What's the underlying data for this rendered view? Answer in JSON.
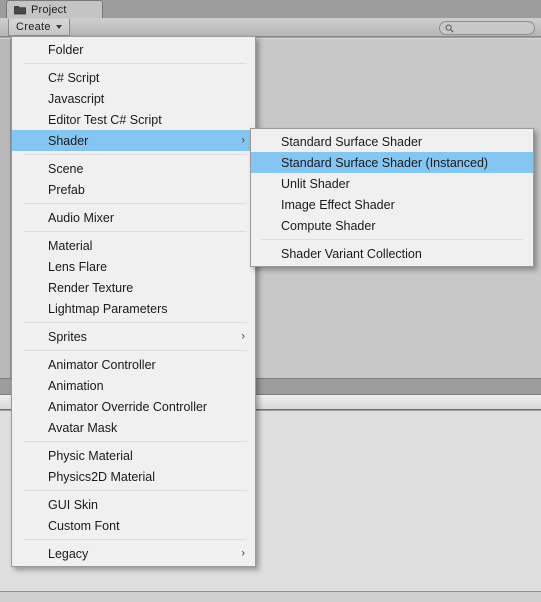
{
  "window": {
    "tab": {
      "label": "Project",
      "icon": "folder-icon"
    }
  },
  "toolbar": {
    "create_label": "Create",
    "create_caret_icon": "chevron-down-icon",
    "search": {
      "value": "",
      "placeholder": "",
      "icon": "search-icon"
    }
  },
  "create_menu": {
    "groups": [
      {
        "items": [
          {
            "label": "Folder",
            "has_submenu": false,
            "highlighted": false
          }
        ]
      },
      {
        "items": [
          {
            "label": "C# Script",
            "has_submenu": false,
            "highlighted": false
          },
          {
            "label": "Javascript",
            "has_submenu": false,
            "highlighted": false
          },
          {
            "label": "Editor Test C# Script",
            "has_submenu": false,
            "highlighted": false
          },
          {
            "label": "Shader",
            "has_submenu": true,
            "highlighted": true
          }
        ]
      },
      {
        "items": [
          {
            "label": "Scene",
            "has_submenu": false,
            "highlighted": false
          },
          {
            "label": "Prefab",
            "has_submenu": false,
            "highlighted": false
          }
        ]
      },
      {
        "items": [
          {
            "label": "Audio Mixer",
            "has_submenu": false,
            "highlighted": false
          }
        ]
      },
      {
        "items": [
          {
            "label": "Material",
            "has_submenu": false,
            "highlighted": false
          },
          {
            "label": "Lens Flare",
            "has_submenu": false,
            "highlighted": false
          },
          {
            "label": "Render Texture",
            "has_submenu": false,
            "highlighted": false
          },
          {
            "label": "Lightmap Parameters",
            "has_submenu": false,
            "highlighted": false
          }
        ]
      },
      {
        "items": [
          {
            "label": "Sprites",
            "has_submenu": true,
            "highlighted": false
          }
        ]
      },
      {
        "items": [
          {
            "label": "Animator Controller",
            "has_submenu": false,
            "highlighted": false
          },
          {
            "label": "Animation",
            "has_submenu": false,
            "highlighted": false
          },
          {
            "label": "Animator Override Controller",
            "has_submenu": false,
            "highlighted": false
          },
          {
            "label": "Avatar Mask",
            "has_submenu": false,
            "highlighted": false
          }
        ]
      },
      {
        "items": [
          {
            "label": "Physic Material",
            "has_submenu": false,
            "highlighted": false
          },
          {
            "label": "Physics2D Material",
            "has_submenu": false,
            "highlighted": false
          }
        ]
      },
      {
        "items": [
          {
            "label": "GUI Skin",
            "has_submenu": false,
            "highlighted": false
          },
          {
            "label": "Custom Font",
            "has_submenu": false,
            "highlighted": false
          }
        ]
      },
      {
        "items": [
          {
            "label": "Legacy",
            "has_submenu": true,
            "highlighted": false
          }
        ]
      }
    ]
  },
  "shader_submenu": {
    "groups": [
      {
        "items": [
          {
            "label": "Standard Surface Shader",
            "has_submenu": false,
            "highlighted": false
          },
          {
            "label": "Standard Surface Shader (Instanced)",
            "has_submenu": false,
            "highlighted": true
          },
          {
            "label": "Unlit Shader",
            "has_submenu": false,
            "highlighted": false
          },
          {
            "label": "Image Effect Shader",
            "has_submenu": false,
            "highlighted": false
          },
          {
            "label": "Compute Shader",
            "has_submenu": false,
            "highlighted": false
          }
        ]
      },
      {
        "items": [
          {
            "label": "Shader Variant Collection",
            "has_submenu": false,
            "highlighted": false
          }
        ]
      }
    ]
  },
  "colors": {
    "menu_background": "#f0f0f0",
    "menu_highlight": "#85c5f2",
    "chrome_background": "#9d9d9d",
    "pane_background": "#c8c8c8",
    "bottom_pane_background": "#dedede",
    "text": "#1a1a1a"
  },
  "icons": {
    "submenu_arrow_glyph": "›"
  }
}
